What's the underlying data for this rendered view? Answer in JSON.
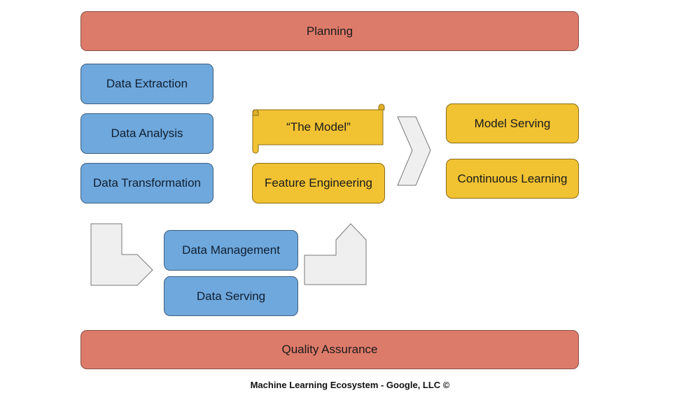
{
  "diagram": {
    "planning": "Planning",
    "data_extraction": "Data Extraction",
    "data_analysis": "Data Analysis",
    "data_transformation": "Data Transformation",
    "the_model": "“The Model”",
    "feature_engineering": "Feature Engineering",
    "model_serving": "Model Serving",
    "continuous_learning": "Continuous Learning",
    "data_management": "Data Management",
    "data_serving": "Data Serving",
    "quality_assurance": "Quality Assurance",
    "footer": "Machine Learning Ecosystem - Google, LLC ©"
  },
  "colors": {
    "planning_qa": "#dd7b6a",
    "data_boxes": "#6fa8dc",
    "model_boxes": "#f1c232",
    "arrows": "#efefef"
  }
}
